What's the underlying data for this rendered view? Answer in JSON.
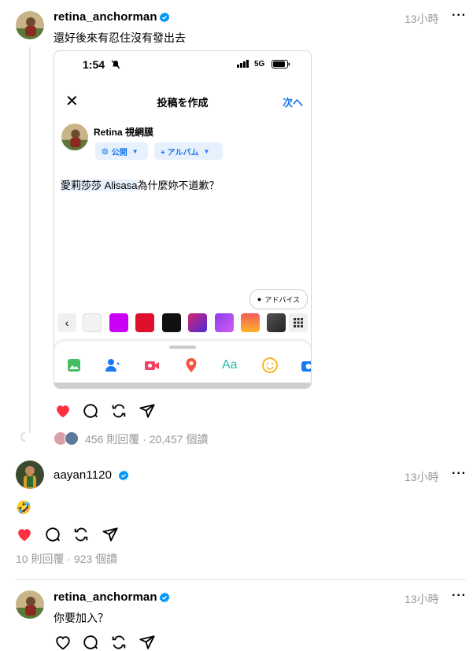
{
  "post1": {
    "username": "retina_anchorman",
    "time": "13小時",
    "more": "···",
    "text": "還好後來有忍住沒有發出去",
    "stats": {
      "replies": "456 則回覆",
      "separator": "·",
      "views": "20,457 個讀"
    },
    "liked": true
  },
  "embedded": {
    "status_time": "1:54",
    "network": "5G",
    "header_title": "投稿を作成",
    "next_label": "次へ",
    "author": "Retina 視網膜",
    "audience_chip": "公開",
    "album_chip": "+ アルバム",
    "mention": "愛莉莎莎 Alisasa",
    "body_rest": "為什麼妳不道歉？",
    "advice_label": "アドバイス",
    "swatches": [
      "#f2f2f2",
      "#c800f5",
      "#e0102d",
      "#111111",
      "#6a2ad4",
      "#b34df0",
      "#f98a2a",
      "#2f3033"
    ]
  },
  "post2": {
    "username": "aayan1120",
    "time": "13小時",
    "more": "···",
    "text": "🤣",
    "stats": {
      "replies": "10 則回覆",
      "separator": "·",
      "views": "923 個讀"
    },
    "liked": true
  },
  "post3": {
    "username": "retina_anchorman",
    "time": "13小時",
    "more": "···",
    "text": "你要加入？",
    "liked": false
  },
  "colors": {
    "like_red": "#ff3040",
    "verified_blue": "#0095f6",
    "meta_gray": "#999999",
    "fb_blue": "#1877f2"
  }
}
